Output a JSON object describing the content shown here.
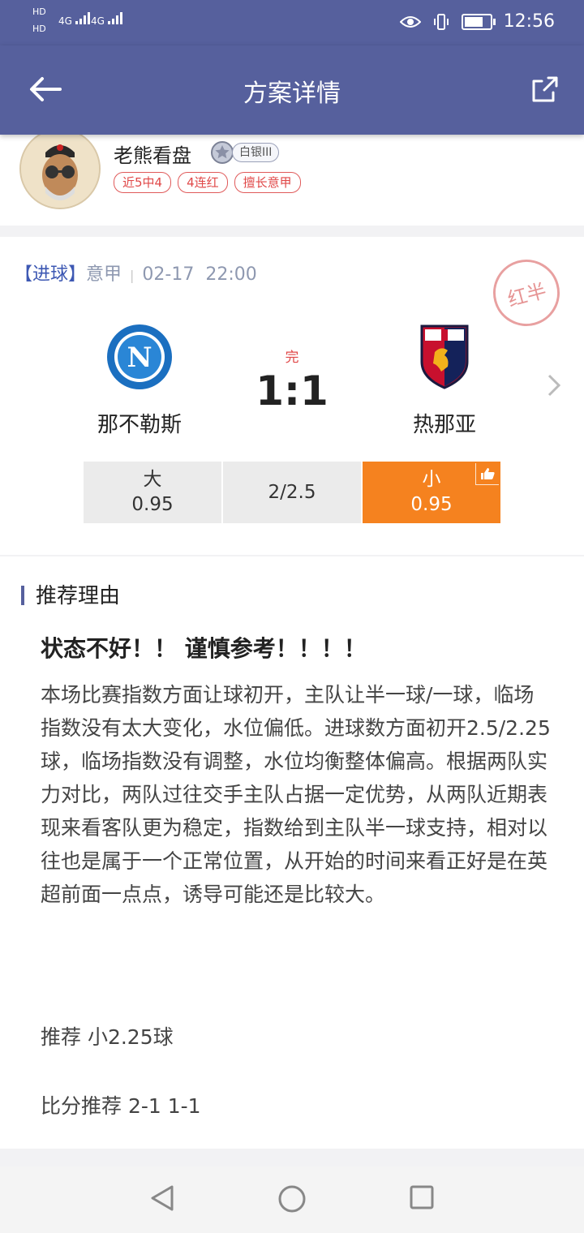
{
  "status": {
    "net1": "HD",
    "net2": "HD",
    "signal1": "4G",
    "signal2": "4G",
    "time": "12:56",
    "battery_level": 0.85,
    "icons": [
      "eye-icon",
      "vibrate-icon",
      "battery-icon"
    ]
  },
  "appbar": {
    "title": "方案详情"
  },
  "author": {
    "name": "老熊看盘",
    "rank": "白银III",
    "tags": [
      "近5中4",
      "4连红",
      "擅长意甲"
    ]
  },
  "match": {
    "type": "【进球】",
    "league": "意甲",
    "sep": "|",
    "date": "02-17",
    "time": "22:00",
    "stamp": "红半",
    "home": {
      "name": "那不勒斯",
      "logo_letter": "N"
    },
    "away": {
      "name": "热那亚"
    },
    "status": "完",
    "score": "1:1",
    "odds": {
      "left_label": "大",
      "left_value": "0.95",
      "line": "2/2.5",
      "right_label": "小",
      "right_value": "0.95"
    }
  },
  "reason": {
    "heading": "推荐理由",
    "headline": "状态不好！！ 谨慎参考！！！！",
    "body": "本场比赛指数方面让球初开，主队让半一球/一球，临场指数没有太大变化，水位偏低。进球数方面初开2.5/2.25球，临场指数没有调整，水位均衡整体偏高。根据两队实力对比，两队过往交手主队占据一定优势，从两队近期表现来看客队更为稳定，指数给到主队半一球支持，相对以往也是属于一个正常位置，从开始的时间来看正好是在英超前面一点点，诱导可能还是比较大。",
    "recommend": "推荐  小2.25球",
    "score_recommend": "比分推荐  2-1  1-1"
  },
  "colors": {
    "primary": "#56609d",
    "accent": "#f5821f",
    "red": "#e04848"
  }
}
